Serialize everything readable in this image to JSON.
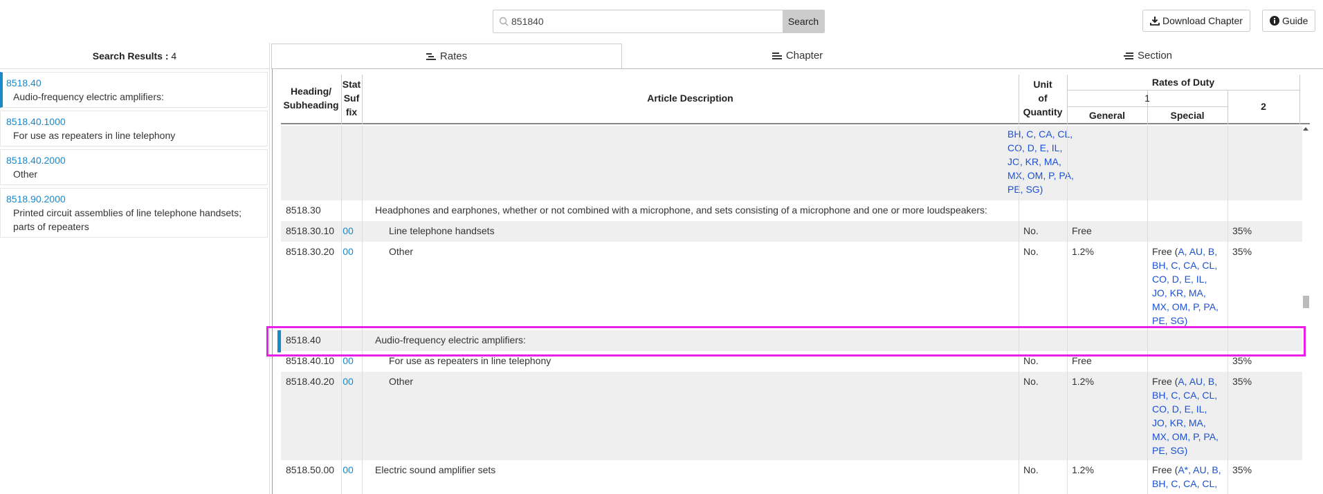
{
  "search": {
    "value": "851840",
    "button": "Search"
  },
  "toolbar": {
    "download_label": "Download Chapter",
    "guide_label": "Guide"
  },
  "sidebar": {
    "header_label": "Search Results :",
    "count": "4",
    "results": [
      {
        "code": "8518.40",
        "desc": "Audio-frequency electric amplifiers:"
      },
      {
        "code": "8518.40.1000",
        "desc": "For use as repeaters in line telephony"
      },
      {
        "code": "8518.40.2000",
        "desc": "Other"
      },
      {
        "code": "8518.90.2000",
        "desc": "Printed circuit assemblies of line telephone handsets; parts of repeaters"
      }
    ]
  },
  "tabs": {
    "rates": "Rates",
    "chapter": "Chapter",
    "section": "Section"
  },
  "table": {
    "headers": {
      "heading1": "Heading/",
      "heading2": "Subheading",
      "stat1": "Stat",
      "stat2": "Suf",
      "stat3": "fix",
      "desc": "Article Description",
      "unit1": "Unit",
      "unit2": "of",
      "unit3": "Quantity",
      "rates": "Rates of Duty",
      "col1": "1",
      "general": "General",
      "special": "Special",
      "col2": "2"
    },
    "rows": [
      {
        "head": "",
        "stat": "",
        "desc": "",
        "unit": "",
        "general": "",
        "special": "BH, C, CA, CL, CO, D, E, IL, JO, KR, MA, MX, OM, P, PA, PE, SG)",
        "col2": ""
      },
      {
        "head": "8518.30",
        "stat": "",
        "desc": "Headphones and earphones, whether or not combined with a microphone, and sets consisting of a microphone and one or more loudspeakers:",
        "unit": "",
        "general": "",
        "special": "",
        "col2": ""
      },
      {
        "head": "8518.30.10",
        "stat": "00",
        "desc": "Line telephone handsets",
        "unit": "No.",
        "general": "Free",
        "special": "",
        "col2": "35%"
      },
      {
        "head": "8518.30.20",
        "stat": "00",
        "desc": "Other",
        "unit": "No.",
        "general": "1.2%",
        "special_prefix": "Free (",
        "special": "A, AU, B, BH, C, CA, CL, CO, D, E, IL, JO, KR, MA, MX, OM, P, PA, PE, SG)",
        "col2": "35%"
      },
      {
        "head": "8518.40",
        "stat": "",
        "desc": "Audio-frequency electric amplifiers:",
        "unit": "",
        "general": "",
        "special": "",
        "col2": ""
      },
      {
        "head": "8518.40.10",
        "stat": "00",
        "desc": "For use as repeaters in line telephony",
        "unit": "No.",
        "general": "Free",
        "special": "",
        "col2": "35%"
      },
      {
        "head": "8518.40.20",
        "stat": "00",
        "desc": "Other",
        "unit": "No.",
        "general": "1.2%",
        "special_prefix": "Free (",
        "special": "A, AU, B, BH, C, CA, CL, CO, D, E, IL, JO, KR, MA, MX, OM, P, PA, PE, SG)",
        "col2": "35%"
      },
      {
        "head": "8518.50.00",
        "stat": "00",
        "desc": "Electric sound amplifier sets",
        "unit": "No.",
        "general": "1.2%",
        "special_prefix": "Free (",
        "special": "A*, AU, B, BH, C, CA, CL,",
        "col2": "35%"
      }
    ]
  },
  "colors": {
    "accent": "#1a87c8",
    "highlight": "#e91ee9",
    "link": "#1a4fd6"
  }
}
